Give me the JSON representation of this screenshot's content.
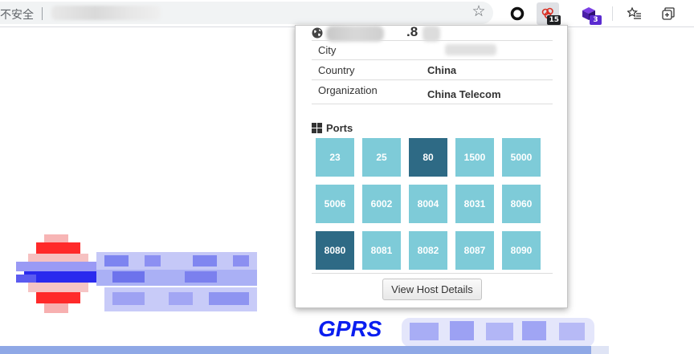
{
  "browser": {
    "security_label": "不安全",
    "colors": {
      "toolbar_bg": "#ffffff",
      "address_bg": "#f1f3f4",
      "shodan_badge": "#202124",
      "purple_badge": "#5b2bd1"
    },
    "extensions": [
      {
        "name": "opera-icon",
        "badge": ""
      },
      {
        "name": "shodan-icon",
        "badge": "15"
      },
      {
        "name": "purple-cube-icon",
        "badge": "3"
      }
    ]
  },
  "popup": {
    "ip_visible_fragment": ".8",
    "info": [
      {
        "label": "City",
        "value": ""
      },
      {
        "label": "Country",
        "value": "China"
      },
      {
        "label": "Organization",
        "value": "China Telecom"
      }
    ],
    "ports_title": "Ports",
    "ports": [
      {
        "number": "23",
        "highlight": false
      },
      {
        "number": "25",
        "highlight": false
      },
      {
        "number": "80",
        "highlight": true
      },
      {
        "number": "1500",
        "highlight": false
      },
      {
        "number": "5000",
        "highlight": false
      },
      {
        "number": "5006",
        "highlight": false
      },
      {
        "number": "6002",
        "highlight": false
      },
      {
        "number": "8004",
        "highlight": false
      },
      {
        "number": "8031",
        "highlight": false
      },
      {
        "number": "8060",
        "highlight": false
      },
      {
        "number": "8080",
        "highlight": true
      },
      {
        "number": "8081",
        "highlight": false
      },
      {
        "number": "8082",
        "highlight": false
      },
      {
        "number": "8087",
        "highlight": false
      },
      {
        "number": "8090",
        "highlight": false
      }
    ],
    "view_button_label": "View Host Details",
    "colors": {
      "port": "#7ecbd8",
      "port_highlight": "#2e6a85"
    }
  },
  "page": {
    "gprs_text": "GPRS"
  }
}
